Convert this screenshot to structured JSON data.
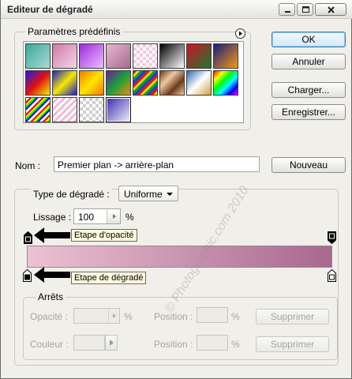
{
  "window": {
    "title": "Editeur de dégradé"
  },
  "presets": {
    "legend": "Paramètres prédéfinis",
    "swatches": [
      "teal-gradient",
      "pink-gradient",
      "violet-gradient",
      "rose-gradient",
      "transparent-pink",
      "black-white",
      "red-green",
      "orange-blue",
      "blue-red-yellow",
      "blue-yellow-blue",
      "orange-yellow-orange",
      "violet-green-orange",
      "rainbow-stripes",
      "copper",
      "chrome",
      "spectrum",
      "rainbow-transparent",
      "pink-transparent",
      "gray-transparent",
      "violet-white"
    ]
  },
  "buttons": {
    "ok": "OK",
    "cancel": "Annuler",
    "load": "Charger...",
    "save": "Enregistrer...",
    "new": "Nouveau",
    "delete_1": "Supprimer",
    "delete_2": "Supprimer"
  },
  "name": {
    "label": "Nom :",
    "value": "Premier plan -> arrière-plan"
  },
  "gradient": {
    "type_label": "Type de dégradé :",
    "type_value": "Uniforme",
    "smooth_label": "Lissage :",
    "smooth_value": "100",
    "smooth_unit": "%",
    "opacity_callout": "Etape d'opacité",
    "color_callout": "Etape de dégradé",
    "start_color": "#ecc2d3",
    "end_color": "#a8688e"
  },
  "stops": {
    "legend": "Arrêts",
    "opacity_label": "Opacité :",
    "opacity_unit": "%",
    "position_label_1": "Position :",
    "position_unit_1": "%",
    "color_label": "Couleur :",
    "position_label_2": "Position :",
    "position_unit_2": "%"
  },
  "watermark": "© Photographic.com 2010"
}
